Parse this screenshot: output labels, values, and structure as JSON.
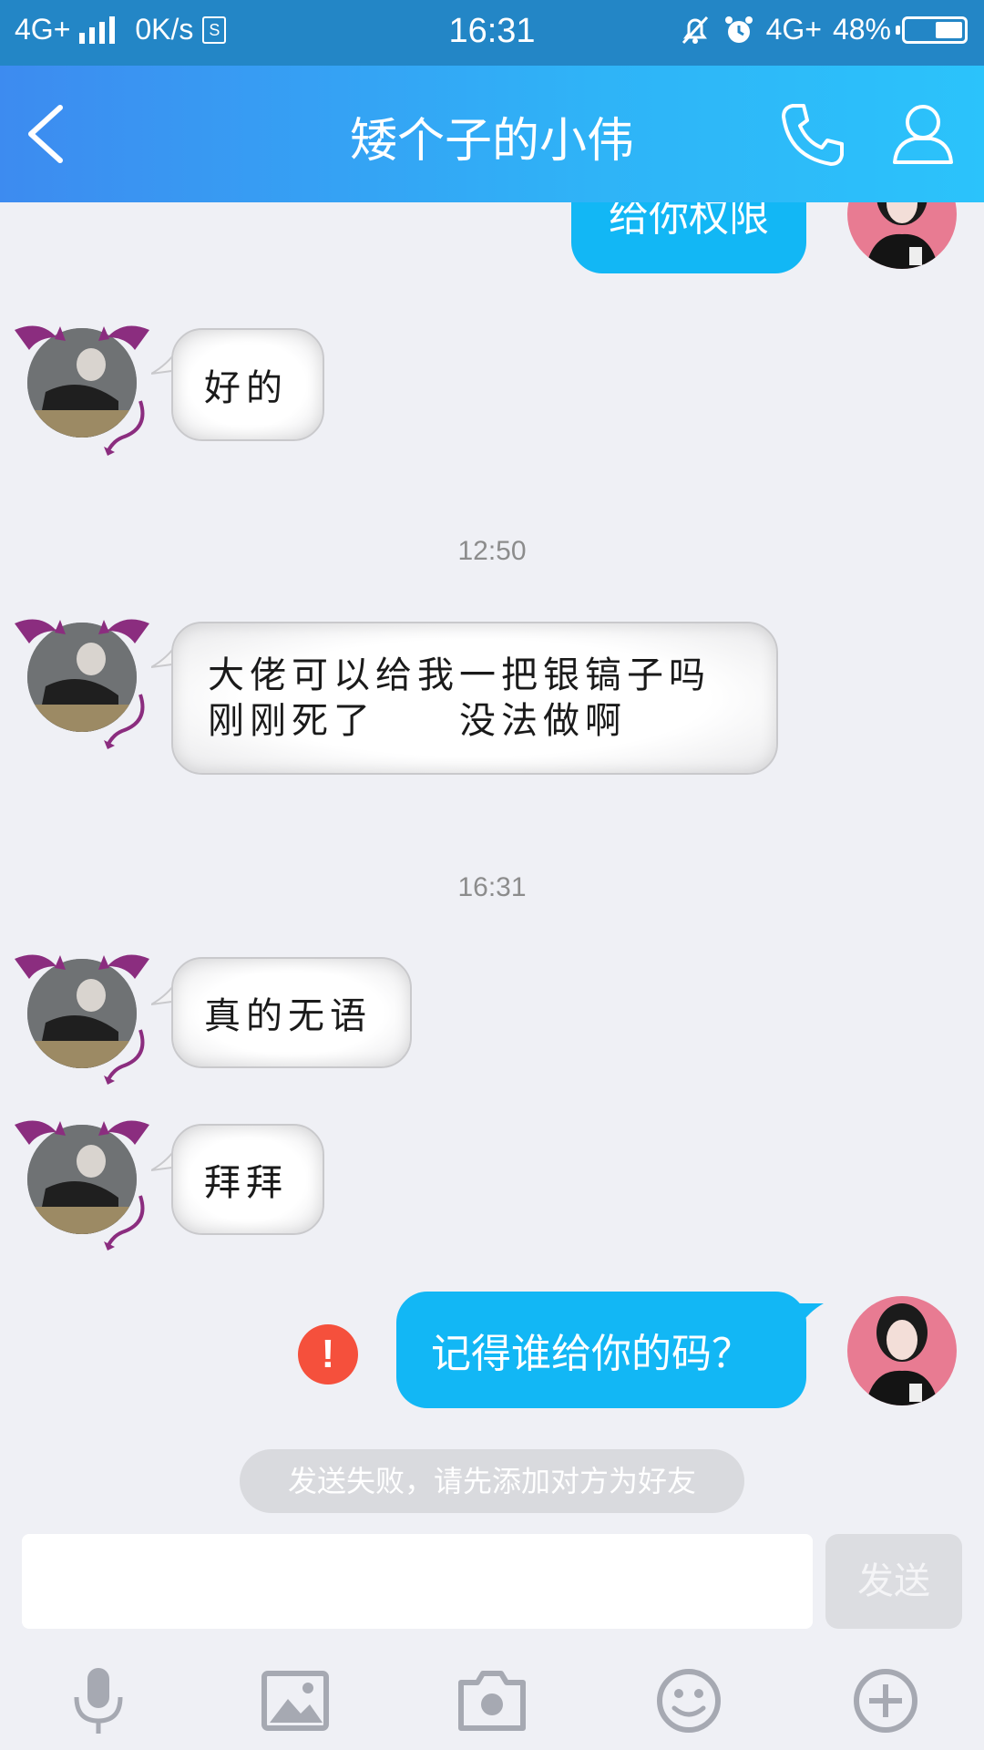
{
  "status_bar": {
    "network": "4G+",
    "speed": "0K/s",
    "sim_icon": "S",
    "time": "16:31",
    "network_right": "4G+",
    "battery": "48%",
    "battery_level": 0.48
  },
  "header": {
    "title": "矮个子的小伟",
    "icons": [
      "back-icon",
      "phone-icon",
      "profile-icon"
    ]
  },
  "messages": [
    {
      "side": "out",
      "text": "给你权限"
    },
    {
      "side": "in",
      "text": "好的"
    },
    {
      "type": "time",
      "text": "12:50"
    },
    {
      "side": "in",
      "line1": "大佬可以给我一把银镐子吗",
      "line2": "刚刚死了　　没法做啊"
    },
    {
      "type": "time",
      "text": "16:31"
    },
    {
      "side": "in",
      "text": "真的无语"
    },
    {
      "side": "in",
      "text": "拜拜"
    },
    {
      "side": "out",
      "text": "记得谁给你的码？",
      "failed": true
    }
  ],
  "error_mark": "!",
  "notice": "发送失败，请先添加对方为好友",
  "input": {
    "value": "",
    "send_label": "发送"
  },
  "toolbar": [
    "microphone-icon",
    "image-icon",
    "camera-icon",
    "emoji-icon",
    "plus-icon"
  ],
  "colors": {
    "accent": "#12b7f5",
    "header_start": "#3d8bf0",
    "header_end": "#2bc3fb",
    "error": "#f5503c"
  }
}
